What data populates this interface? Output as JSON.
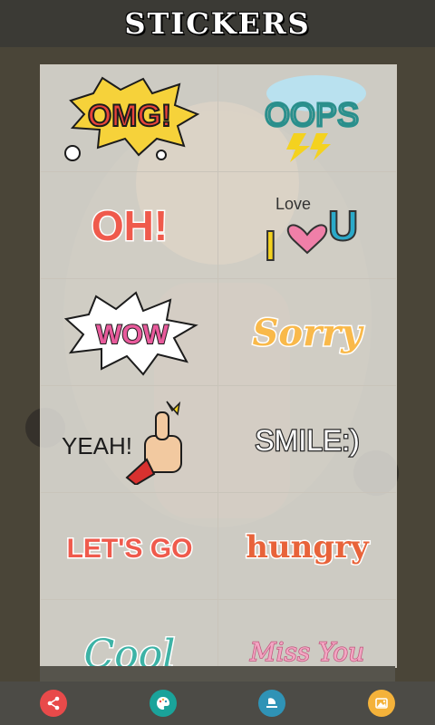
{
  "header": {
    "title": "STICKERS"
  },
  "stickers": [
    {
      "text": "OMG!",
      "colors": {
        "fill": "#e8443a",
        "burst": "#f6d23a",
        "outline": "#1c1c1c"
      }
    },
    {
      "text": "OOPS",
      "colors": {
        "fill": "#2a8f8c",
        "cloud": "#b9e1ef",
        "bolt": "#f4d21f"
      }
    },
    {
      "text": "OH!",
      "colors": {
        "fill": "#ef5a4c"
      }
    },
    {
      "text_top": "Love",
      "letter": "I",
      "letter_end": "U",
      "colors": {
        "fill": "#f4d21f",
        "heart": "#ef7fa8",
        "u": "#2aa9c9"
      }
    },
    {
      "text": "WOW",
      "colors": {
        "fill": "#e85a9b",
        "burst": "#ffffff"
      }
    },
    {
      "text": "Sorry",
      "colors": {
        "fill": "#f9b94a"
      }
    },
    {
      "text": "YEAH!",
      "colors": {
        "fill": "#1c1c1c",
        "hand": "#f2c9a0",
        "sleeve": "#d8312f"
      }
    },
    {
      "text": "SMILE:)",
      "colors": {
        "fill": "#ffffff",
        "stroke": "#2a2a2a"
      }
    },
    {
      "text": "LET'S GO",
      "colors": {
        "fill": "#ef5a4c",
        "accent": "#9bd24a"
      }
    },
    {
      "text": "hungry",
      "colors": {
        "fill": "#e8633a"
      }
    },
    {
      "text": "Cool",
      "colors": {
        "fill": "#3db3a6"
      }
    },
    {
      "text": "Miss You",
      "colors": {
        "fill": "#f3a6c3"
      }
    }
  ],
  "bottom_bar": {
    "buttons": [
      {
        "icon": "share-icon",
        "color": "#e84a4a"
      },
      {
        "icon": "palette-icon",
        "color": "#1aa39a"
      },
      {
        "icon": "layers-icon",
        "color": "#2f93b6"
      },
      {
        "icon": "gallery-icon",
        "color": "#f4b23a"
      }
    ]
  }
}
